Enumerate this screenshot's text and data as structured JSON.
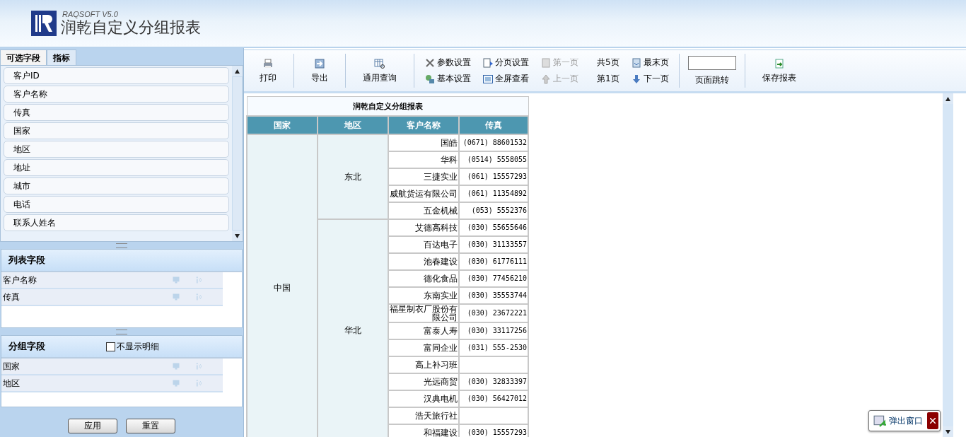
{
  "header": {
    "brand_sub": "RAQSOFT  V5.0",
    "title": "润乾自定义分组报表"
  },
  "left_panel": {
    "tabs": [
      {
        "label": "可选字段",
        "selected": true
      },
      {
        "label": "指标",
        "selected": false
      }
    ],
    "field_list": [
      "客户ID",
      "客户名称",
      "传真",
      "国家",
      "地区",
      "地址",
      "城市",
      "电话",
      "联系人姓名"
    ],
    "list_fields": {
      "title": "列表字段",
      "items": [
        "客户名称",
        "传真"
      ]
    },
    "group_fields": {
      "title": "分组字段",
      "checkbox": {
        "label": "不显示明细",
        "checked": false
      },
      "items": [
        "国家",
        "地区"
      ]
    },
    "buttons": [
      "应用",
      "重置"
    ]
  },
  "toolbar": [
    {
      "kind": "large",
      "label": "打印"
    },
    {
      "kind": "large",
      "label": "导出"
    },
    {
      "kind": "large",
      "label": "通用查询"
    },
    {
      "kind": "stack",
      "items": [
        {
          "kind": "action",
          "label": "参数设置",
          "disabled": false
        },
        {
          "kind": "action",
          "label": "基本设置",
          "disabled": false
        }
      ]
    },
    {
      "kind": "stack",
      "items": [
        {
          "kind": "action",
          "label": "分页设置",
          "disabled": false
        },
        {
          "kind": "action",
          "label": "全屏查看",
          "disabled": false
        }
      ]
    },
    {
      "kind": "stack",
      "items": [
        {
          "kind": "action",
          "label": "第一页",
          "disabled": true
        },
        {
          "kind": "action",
          "label": "上一页",
          "disabled": true
        }
      ]
    },
    {
      "kind": "stack",
      "items": [
        {
          "kind": "text",
          "label": "共5页"
        },
        {
          "kind": "text",
          "label": "第1页"
        }
      ]
    },
    {
      "kind": "stack",
      "items": [
        {
          "kind": "action",
          "label": "最末页",
          "disabled": false
        },
        {
          "kind": "action",
          "label": "下一页",
          "disabled": false
        }
      ]
    },
    {
      "kind": "jump",
      "label": "页面跳转"
    },
    {
      "kind": "large",
      "label": "保存报表"
    }
  ],
  "report": {
    "title": "润乾自定义分组报表",
    "columns": [
      "国家",
      "地区",
      "客户名称",
      "传真"
    ],
    "rows": [
      {
        "country": "中国",
        "regions": [
          {
            "name": "东北",
            "customers": [
              {
                "name": "国皓",
                "fax": "(0671) 88601532"
              },
              {
                "name": "华科",
                "fax": "(0514) 5558055"
              },
              {
                "name": "三捷实业",
                "fax": "(061) 15557293"
              },
              {
                "name": "威航货运有限公司",
                "fax": "(061) 11354892"
              },
              {
                "name": "五金机械",
                "fax": "(053) 5552376"
              }
            ]
          },
          {
            "name": "华北",
            "customers": [
              {
                "name": "艾德高科技",
                "fax": "(030) 55655646"
              },
              {
                "name": "百达电子",
                "fax": "(030) 31133557"
              },
              {
                "name": "池春建设",
                "fax": "(030) 61776111"
              },
              {
                "name": "德化食品",
                "fax": "(030) 77456210"
              },
              {
                "name": "东南实业",
                "fax": "(030) 35553744"
              },
              {
                "name": "福星制衣厂股份有限公司",
                "fax": "(030) 23672221"
              },
              {
                "name": "富泰人寿",
                "fax": "(030) 33117256"
              },
              {
                "name": "富同企业",
                "fax": "(031) 555-2530"
              },
              {
                "name": "高上补习班"
              },
              {
                "name": "光远商贸",
                "fax": "(030) 32833397"
              },
              {
                "name": "汉典电机",
                "fax": "(030) 56427012"
              },
              {
                "name": "浩天旅行社"
              },
              {
                "name": "和福建设",
                "fax": "(030) 15557293"
              }
            ]
          }
        ]
      }
    ]
  },
  "popup": {
    "label": "弹出窗口"
  }
}
